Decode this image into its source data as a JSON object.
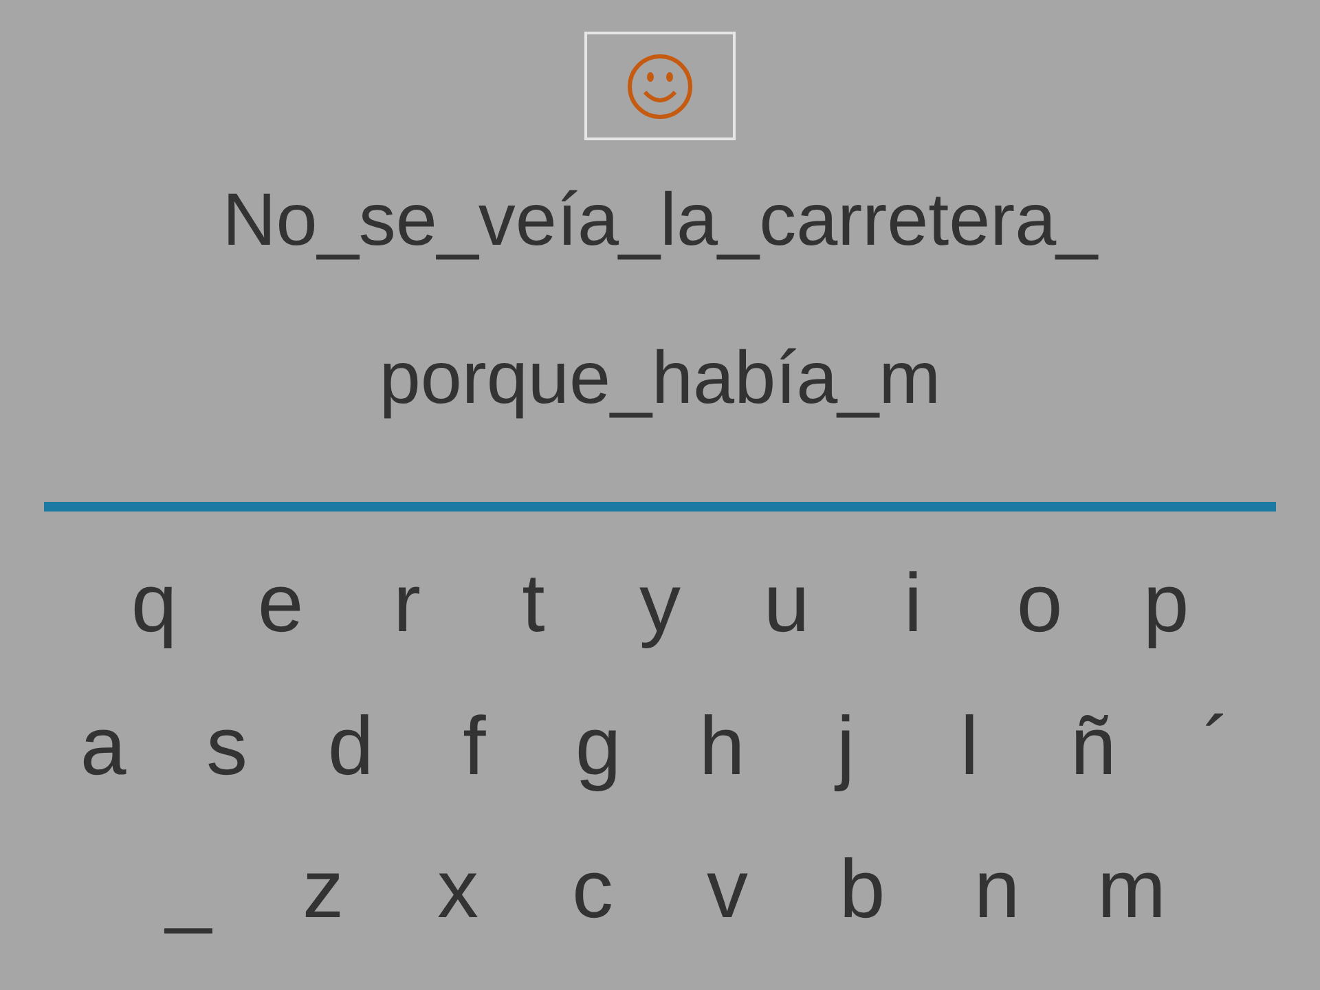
{
  "sentence": {
    "lines": [
      "No_se_veía_la_carretera_",
      "porque_había_m"
    ]
  },
  "keyboard": {
    "rows": [
      [
        "q",
        "e",
        "r",
        "t",
        "y",
        "u",
        "i",
        "o",
        "p"
      ],
      [
        "a",
        "s",
        "d",
        "f",
        "g",
        "h",
        "j",
        "l",
        "ñ",
        "´"
      ],
      [
        "_",
        "z",
        "x",
        "c",
        "v",
        "b",
        "n",
        "m"
      ]
    ]
  }
}
